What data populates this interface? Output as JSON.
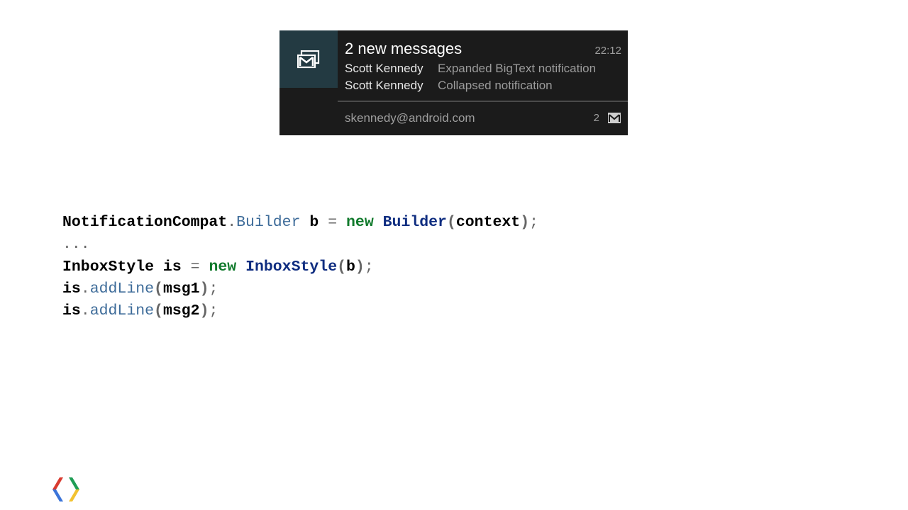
{
  "notification": {
    "title": "2 new messages",
    "time": "22:12",
    "lines": [
      {
        "sender": "Scott Kennedy",
        "message": "Expanded BigText notification"
      },
      {
        "sender": "Scott Kennedy",
        "message": "Collapsed notification"
      }
    ],
    "account": "skennedy@android.com",
    "count": "2",
    "icon": "gmail-stack-icon",
    "small_icon": "mail-icon",
    "colors": {
      "background": "#1b1b1b",
      "icon_box": "#233a42"
    }
  },
  "code": {
    "line1": {
      "a": "NotificationCompat",
      "b": ".",
      "c": "Builder",
      "d": " b ",
      "e": "=",
      "f": " ",
      "g": "new",
      "h": " ",
      "i": "Builder",
      "j": "(",
      "k": "context",
      "l": ")",
      "m": ";"
    },
    "line2": {
      "a": "..."
    },
    "line3": {
      "a": "InboxStyle is ",
      "b": "=",
      "c": " ",
      "d": "new",
      "e": " ",
      "f": "InboxStyle",
      "g": "(",
      "h": "b",
      "i": ")",
      "j": ";"
    },
    "line4": {
      "a": "is",
      "b": ".",
      "c": "addLine",
      "d": "(",
      "e": "msg1",
      "f": ")",
      "g": ";"
    },
    "line5": {
      "a": "is",
      "b": ".",
      "c": "addLine",
      "d": "(",
      "e": "msg2",
      "f": ")",
      "g": ";"
    },
    "colors": {
      "keyword": "#117a2c",
      "type": "#0f2d80",
      "method": "#3d6b99",
      "punctuation": "#666666"
    }
  },
  "logo": {
    "icon": "google-developers-logo"
  }
}
